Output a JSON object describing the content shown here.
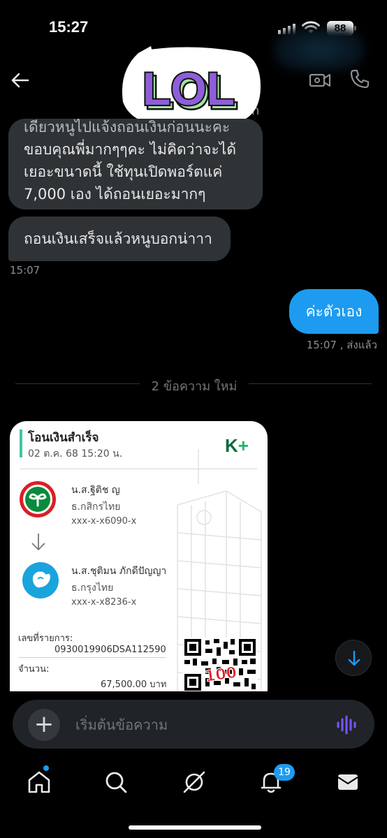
{
  "status_bar": {
    "time": "15:27",
    "battery": "88"
  },
  "header": {
    "subtitle": "n"
  },
  "sticker": {
    "text": "LOL"
  },
  "messages": {
    "incoming1_lines": [
      "เดียวหนูไปแจ้งถอนเงินก่อนนะคะ",
      "ขอบคุณพี่มากๆๆคะ ไม่คิดว่าจะได้",
      "เยอะขนาดนี้ ใช้ทุนเปิดพอร์ตแค่",
      "7,000 เอง ได้ถอนเยอะมากๆ"
    ],
    "incoming2": "ถอนเงินเสร็จแล้วหนูบอกน่าาา",
    "incoming_time": "15:07",
    "outgoing": "ค่ะตัวเอง",
    "outgoing_time": "15:07 , ส่งแล้ว"
  },
  "divider": {
    "label": "2 ข้อความ ใหม่"
  },
  "receipt": {
    "title": "โอนเงินสำเร็จ",
    "date": "02 ต.ค. 68 15:20 น.",
    "brand": "K",
    "brand_plus": "+",
    "sender": {
      "name": "น.ส.ฐิติช ญ",
      "bank": "ธ.กสิกรไทย",
      "account": "xxx-x-x6090-x"
    },
    "receiver": {
      "name": "น.ส.ชุติมน ภักดีปัญญา",
      "bank": "ธ.กรุงไทย",
      "account": "xxx-x-x8236-x"
    },
    "ref_label": "เลขที่รายการ:",
    "ref_value": "0930019906DSA112590",
    "amount_label": "จำนวน:",
    "amount_value": "67,500.00 บาท",
    "stamp": "100"
  },
  "composer": {
    "placeholder": "เริ่มต้นข้อความ",
    "plus": "+"
  },
  "tabbar": {
    "notifications_badge": "19"
  },
  "icons": {
    "back": "arrow-left-icon",
    "video": "video-camera-icon",
    "call": "phone-icon",
    "voice": "voice-wave-icon",
    "scroll": "arrow-down-icon",
    "home": "home-icon",
    "search": "search-icon",
    "grok": "slash-circle-icon",
    "bell": "bell-icon",
    "mail": "mail-icon"
  },
  "colors": {
    "accent": "#1d9bf0",
    "bubble_in": "#2f3336",
    "voice": "#7856ff",
    "kbank_green": "#0b6b3a"
  }
}
